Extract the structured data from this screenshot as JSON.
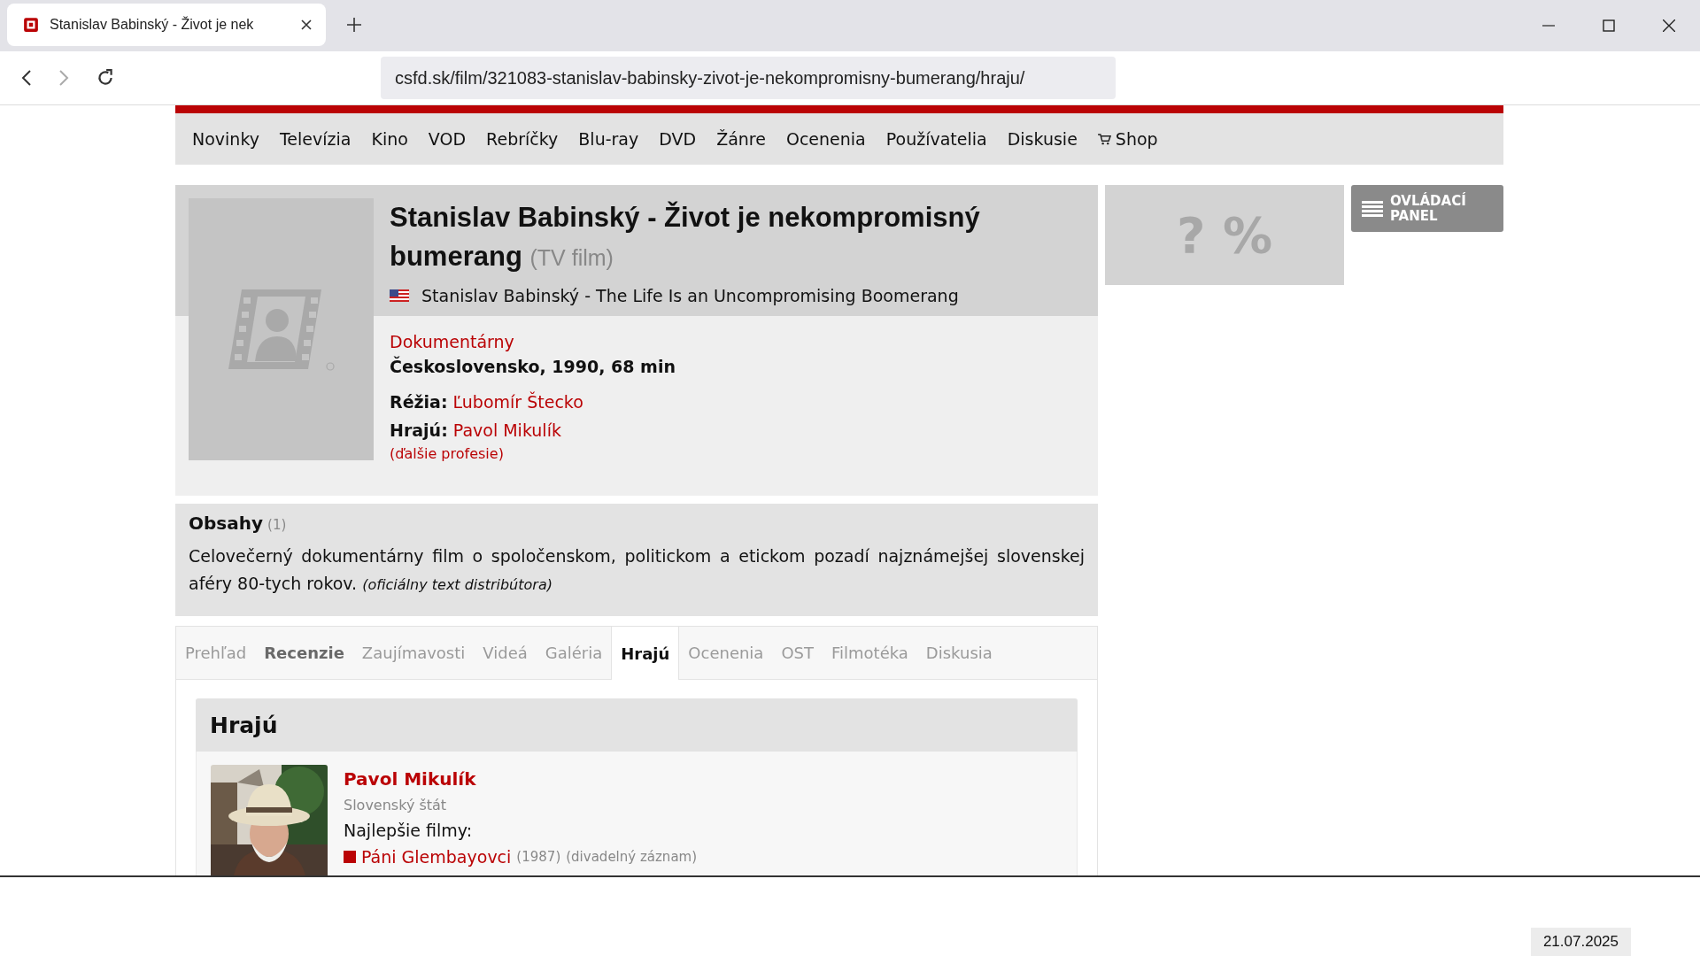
{
  "browser": {
    "tab_title": "Stanislav Babinský - Život je nek",
    "url": "csfd.sk/film/321083-stanislav-babinsky-zivot-je-nekompromisny-bumerang/hraju/"
  },
  "nav": [
    {
      "label": "Novinky",
      "kind": "link"
    },
    {
      "label": "Televízia",
      "kind": "link"
    },
    {
      "label": "Kino",
      "kind": "link"
    },
    {
      "label": "VOD",
      "kind": "link"
    },
    {
      "label": "Rebríčky",
      "kind": "link"
    },
    {
      "label": "Blu-ray",
      "kind": "link"
    },
    {
      "label": "DVD",
      "kind": "link"
    },
    {
      "label": "Žánre",
      "kind": "link"
    },
    {
      "label": "Ocenenia",
      "kind": "link"
    },
    {
      "label": "Používatelia",
      "kind": "link"
    },
    {
      "label": "Diskusie",
      "kind": "link"
    },
    {
      "label": "Shop",
      "kind": "shop"
    }
  ],
  "film": {
    "title": "Stanislav Babinský - Život je nekompromisný bumerang",
    "type": "(TV film)",
    "en_title": "Stanislav Babinský - The Life Is an Uncompromising Boomerang",
    "genre": "Dokumentárny",
    "origin": "Československo, 1990, 68 min",
    "credits": [
      {
        "label": "Réžia:",
        "value": "Ľubomír Štecko"
      },
      {
        "label": "Hrajú:",
        "value": "Pavol Mikulík"
      }
    ],
    "more": "(ďalšie profesie)"
  },
  "rating": "? %",
  "control_panel": "OVLÁDACÍ PANEL",
  "plot": {
    "heading": "Obsahy",
    "count": "(1)",
    "text": "Celovečerný dokumentárny film o spoločenskom, politickom a etickom pozadí najznámejšej slovenskej aféry 80-tych rokov.",
    "source": "(oficiálny text distribútora)"
  },
  "tabs": [
    {
      "label": "Prehľad",
      "selected": false,
      "disabled": true
    },
    {
      "label": "Recenzie",
      "selected": false,
      "disabled": false
    },
    {
      "label": "Zaujímavosti",
      "selected": false,
      "disabled": true
    },
    {
      "label": "Videá",
      "selected": false,
      "disabled": true
    },
    {
      "label": "Galéria",
      "selected": false,
      "disabled": true
    },
    {
      "label": "Hrajú",
      "selected": true,
      "disabled": false
    },
    {
      "label": "Ocenenia",
      "selected": false,
      "disabled": true
    },
    {
      "label": "OST",
      "selected": false,
      "disabled": true
    },
    {
      "label": "Filmotéka",
      "selected": false,
      "disabled": true
    },
    {
      "label": "Diskusia",
      "selected": false,
      "disabled": true
    }
  ],
  "cast": {
    "heading": "Hrajú",
    "actors": [
      {
        "name": "Pavol Mikulík",
        "origin": "Slovenský štát",
        "best_label": "Najlepšie filmy:",
        "films": [
          {
            "title": "Páni Glembayovci",
            "year": "(1987)",
            "note": "(divadelný záznam)"
          }
        ]
      }
    ]
  },
  "date": "21.07.2025"
}
